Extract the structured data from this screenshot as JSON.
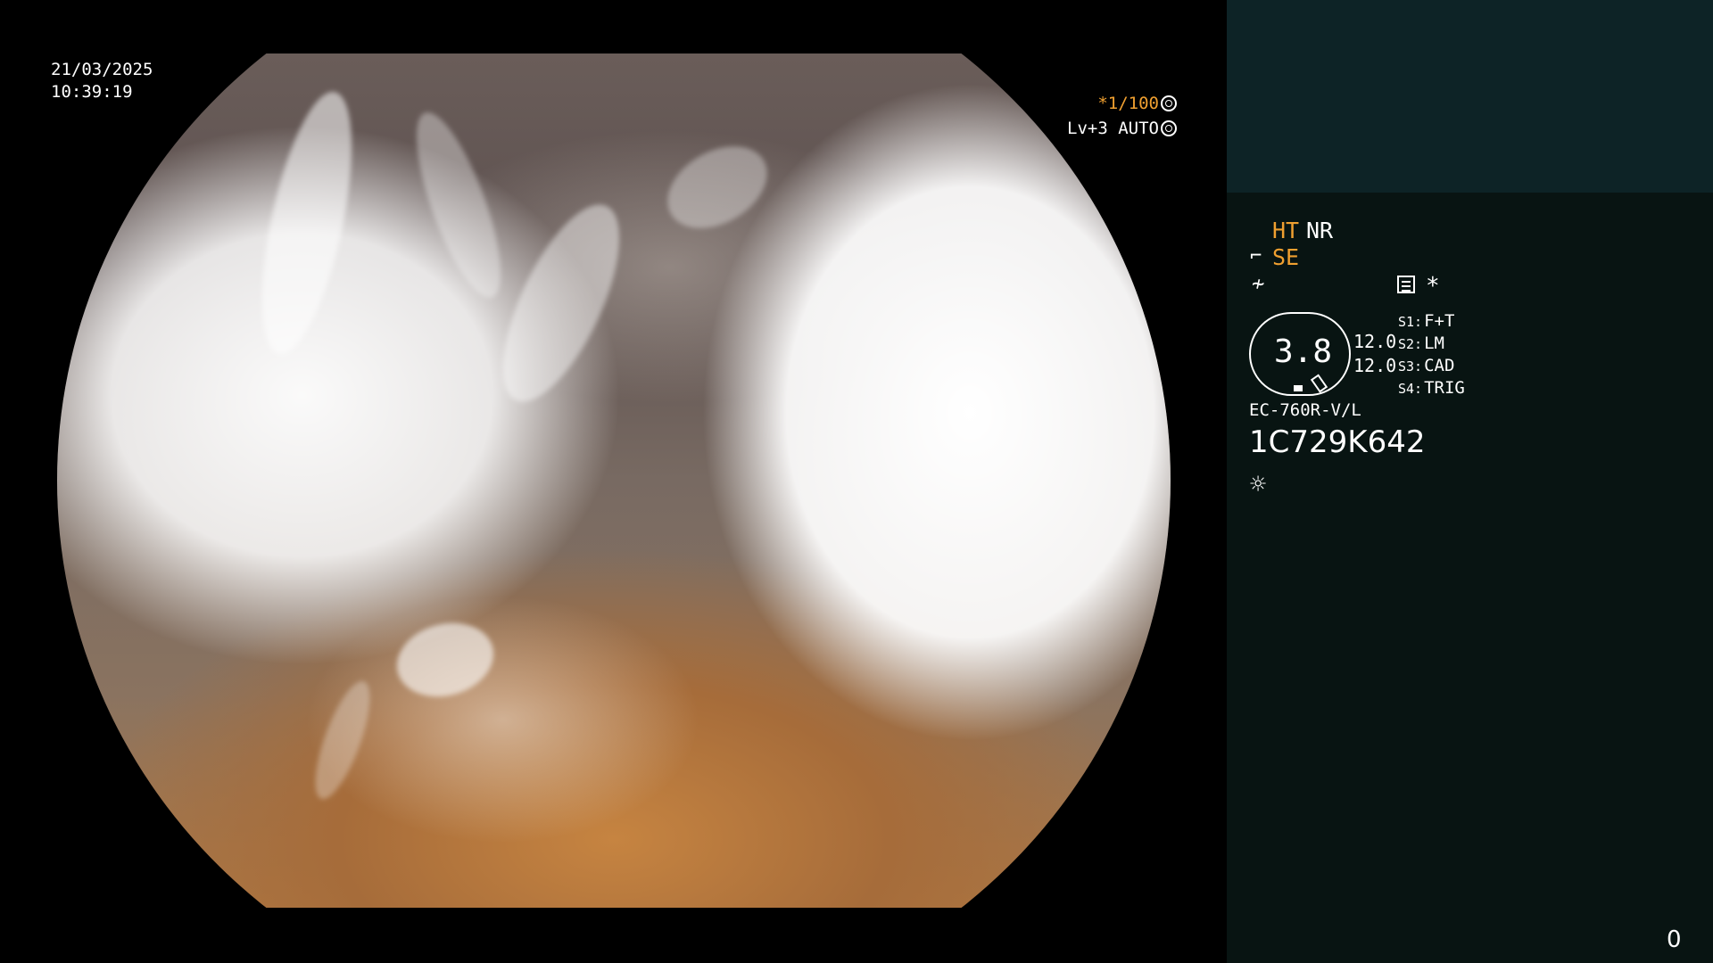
{
  "overlay": {
    "date": "21/03/2025",
    "time": "10:39:19",
    "shutter_text": "*1/100",
    "level_text": "Lv+3 AUTO"
  },
  "panel": {
    "ht_label": "HT",
    "nr_label": "NR",
    "se_label": "SE",
    "star_label": "*",
    "gauge_value": "3.8",
    "value_1": "12.0",
    "value_2": "12.0",
    "switches": [
      {
        "key": "S1:",
        "value": "F+T"
      },
      {
        "key": "S2:",
        "value": "LM"
      },
      {
        "key": "S3:",
        "value": "CAD"
      },
      {
        "key": "S4:",
        "value": "TRIG"
      }
    ],
    "model": "EC-760R-V/L",
    "serial": "1C729K642",
    "page_counter": "0"
  },
  "icons": {
    "se_icon": "scope-curve-icon",
    "f_icon": "f-slash-icon",
    "doc_icon": "memo-icon",
    "sun_icon": "light-source-icon",
    "shutter_icon": "aperture-icon",
    "level_icon": "iris-icon"
  },
  "colors": {
    "accent": "#f0a030",
    "panel_top": "#0d2326",
    "panel_bg": "#081412",
    "background": "#000000"
  }
}
